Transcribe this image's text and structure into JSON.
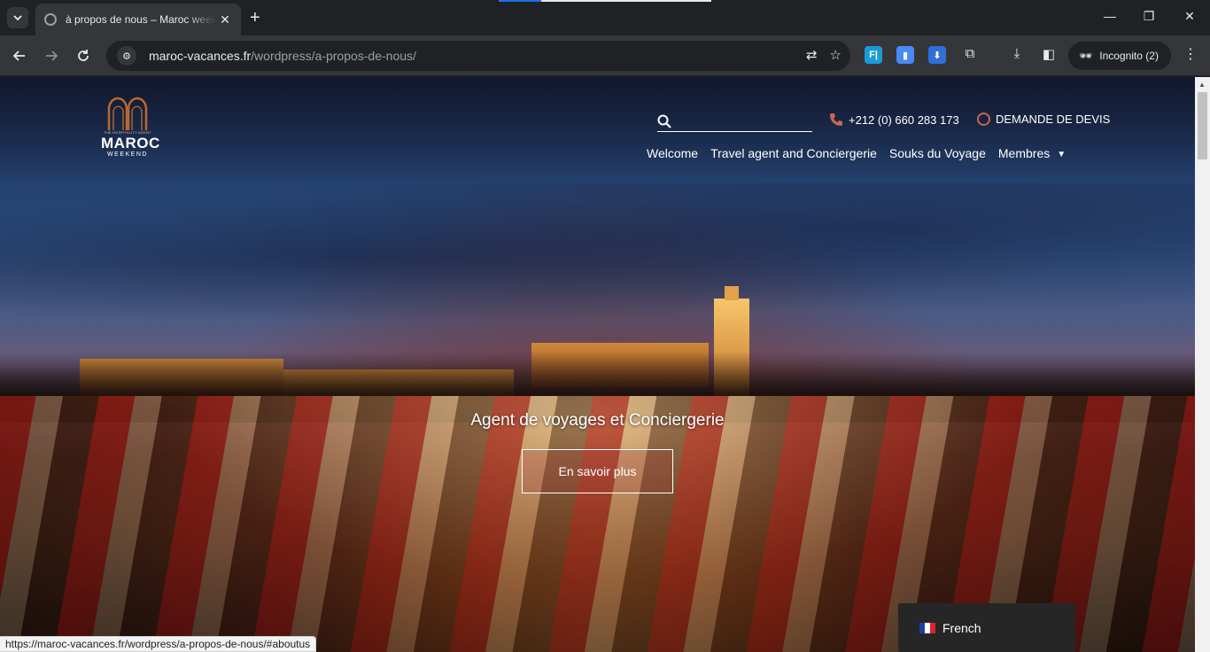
{
  "browser": {
    "tab_title": "à propos de nous – Maroc weekend",
    "url_domain": "maroc-vacances.fr",
    "url_path": "/wordpress/a-propos-de-nous/",
    "incognito_label": "Incognito (2)",
    "status_url": "https://maroc-vacances.fr/wordpress/a-propos-de-nous/#aboutus",
    "extension_label": "F|"
  },
  "site": {
    "logo": {
      "tagline": "THE HOSPITALITY AGENT",
      "name": "MAROC",
      "sub": "WEEKEND"
    },
    "search": {
      "placeholder": ""
    },
    "phone": "+212 (0) 660 283 173",
    "quote_label": "DEMANDE DE DEVIS",
    "nav": [
      {
        "label": "Welcome"
      },
      {
        "label": "Travel agent and Conciergerie"
      },
      {
        "label": "Souks du Voyage"
      },
      {
        "label": "Membres"
      }
    ],
    "hero": {
      "title": "Agent de voyages et Conciergerie",
      "button": "En savoir plus"
    },
    "language": "French",
    "colors": {
      "accent": "#c9654f",
      "logo_arch": "#b8682e"
    }
  }
}
